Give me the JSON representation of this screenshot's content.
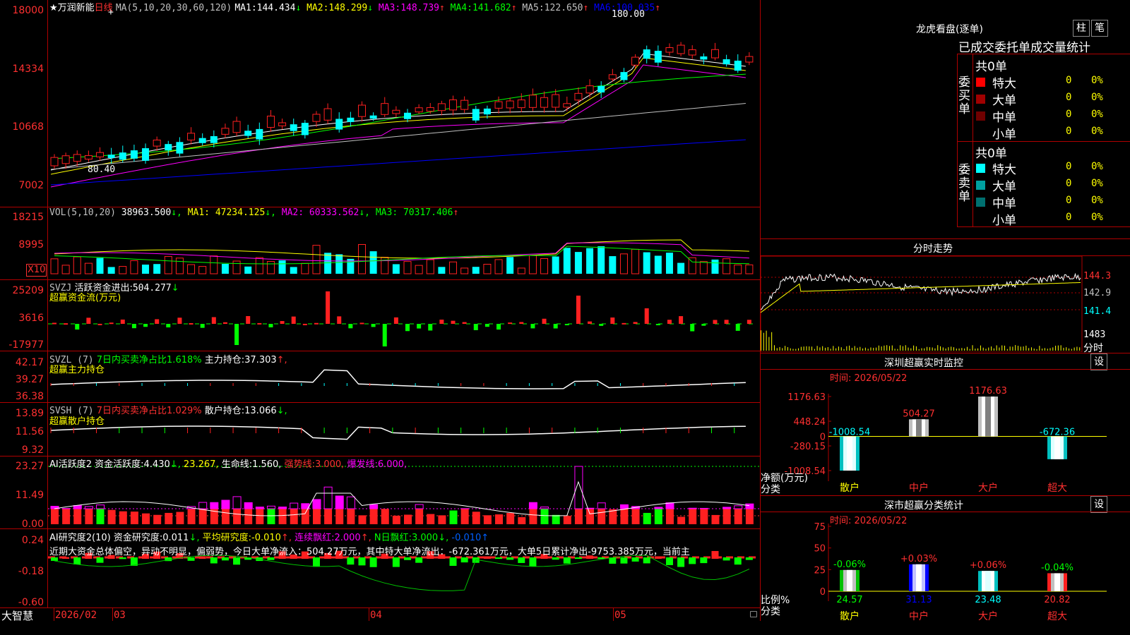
{
  "stock": {
    "star": "★",
    "name": "万润新能",
    "period": "日线",
    "cross": "+"
  },
  "colors": {
    "up": "#ff2020",
    "down": "#00ffff",
    "ma1": "#ffffff",
    "ma2": "#ffff00",
    "ma3": "#ff00ff",
    "ma4": "#00ff00",
    "ma5": "#c0c0c0",
    "ma6": "#0000ff",
    "grid": "#b00000"
  },
  "main": {
    "ma_header": "MA(5,10,20,30,60,120)",
    "ma": [
      {
        "name": "MA1:",
        "value": "144.434",
        "arrow": "↓",
        "color": "#ffffff"
      },
      {
        "name": "MA2:",
        "value": "148.299",
        "arrow": "↓",
        "color": "#ffff00"
      },
      {
        "name": "MA3:",
        "value": "148.739",
        "arrow": "↑",
        "color": "#ff00ff"
      },
      {
        "name": "MA4:",
        "value": "141.682",
        "arrow": "↑",
        "color": "#00ff00"
      },
      {
        "name": "MA5:",
        "value": "122.650",
        "arrow": "↑",
        "color": "#c0c0c0"
      },
      {
        "name": "MA6:",
        "value": "100.035",
        "arrow": "↑",
        "color": "#0000ff"
      }
    ],
    "axis": [
      "18000",
      "14334",
      "10668",
      "7002"
    ],
    "high_label": "180.00",
    "low_label": "80.40"
  },
  "vol": {
    "header": "VOL(5,10,20)",
    "value": "38963.500",
    "value_arrow": "↓",
    "ma": [
      {
        "name": "MA1:",
        "value": "47234.125",
        "arrow": "↓",
        "color": "#ffff00"
      },
      {
        "name": "MA2:",
        "value": "60333.562",
        "arrow": "↓",
        "color": "#ff00ff"
      },
      {
        "name": "MA3:",
        "value": "70317.406",
        "arrow": "↑",
        "color": "#00ff00"
      }
    ],
    "axis": [
      "18215",
      "8995"
    ],
    "unit": "X10"
  },
  "svzj": {
    "header": "SVZJ",
    "label": "活跃资金进出:",
    "value": "504.277",
    "arrow": "↓",
    "title2": "超赢资金流(万元)",
    "axis": [
      "25209",
      "3616",
      "-17977"
    ]
  },
  "svzl": {
    "header": "SVZL (7)",
    "ratio_label": "7日内买卖净占比1.618%",
    "hold_label": "主力持仓:",
    "hold_value": "37.303",
    "arrow": "↑,",
    "title2": "超赢主力持仓",
    "axis": [
      "42.17",
      "39.27",
      "36.38"
    ]
  },
  "svsh": {
    "header": "SVSH (7)",
    "ratio_label": "7日内买卖净占比1.029%",
    "hold_label": "散户持仓:",
    "hold_value": "13.066",
    "arrow": "↓,",
    "title2": "超赢散户持仓",
    "axis": [
      "13.89",
      "11.56",
      "9.32"
    ]
  },
  "ai_active": {
    "header": "AI活跃度2",
    "label": "资金活跃度:",
    "value": "4.430",
    "arrow": "↓,",
    "v2": "23.267,",
    "life_label": "生命线:",
    "life_value": "1.560,",
    "strong_label": "强势线:",
    "strong_value": "3.000,",
    "burst_label": "爆发线:",
    "burst_value": "6.000,",
    "axis": [
      "23.27",
      "11.49",
      "0.00"
    ]
  },
  "ai_research": {
    "header": "AI研究度2(10)",
    "label": "资金研究度:",
    "value": "0.011",
    "arrow": "↓,",
    "avg_label": "平均研究度:",
    "avg_value": "-0.010",
    "avg_arrow": "↑,",
    "cont_label": "连续飘红:",
    "cont_value": "2.000",
    "cont_arrow": "↑,",
    "n_label": "N日飘红:",
    "n_value": "3.000",
    "n_arrow": "↓,",
    "tail": "-0.010↑",
    "comment": "近期大资金总体偏空，异动不明显，偏弱势，今日大单净流入：504.27万元，其中特大单净流出：-672.361万元，大单5日累计净出-9753.385万元，当前主",
    "axis": [
      "0.24",
      "-0.18",
      "-0.60"
    ]
  },
  "bottom": {
    "brand": "大智慧",
    "dates": [
      "2026/02",
      "03",
      "04",
      "05"
    ]
  },
  "dragon": {
    "title": "龙虎看盘(逐单)",
    "btn1": "柱",
    "btn2": "笔",
    "subtitle": "已成交委托单成交量统计",
    "buy": {
      "side": "委买单",
      "total": "共0单",
      "rows": [
        {
          "label": "特大",
          "count": "0",
          "pct": "0%",
          "color": "#ff0000"
        },
        {
          "label": "大单",
          "count": "0",
          "pct": "0%",
          "color": "#a00000"
        },
        {
          "label": "中单",
          "count": "0",
          "pct": "0%",
          "color": "#700000"
        },
        {
          "label": "小单",
          "count": "0",
          "pct": "0%",
          "color": "#000000"
        }
      ]
    },
    "sell": {
      "side": "委卖单",
      "total": "共0单",
      "rows": [
        {
          "label": "特大",
          "count": "0",
          "pct": "0%",
          "color": "#00ffff"
        },
        {
          "label": "大单",
          "count": "0",
          "pct": "0%",
          "color": "#00a0a0"
        },
        {
          "label": "中单",
          "count": "0",
          "pct": "0%",
          "color": "#007070"
        },
        {
          "label": "小单",
          "count": "0",
          "pct": "0%",
          "color": "#000000"
        }
      ]
    }
  },
  "intraday": {
    "title": "分时走势",
    "axis": [
      "144.3",
      "142.9",
      "141.4",
      "1483"
    ],
    "tag": "分时"
  },
  "monitor": {
    "title": "深圳超赢实时监控",
    "btn": "设",
    "time": "时间: 2026/05/22",
    "axis": [
      "1176.63",
      "448.24",
      "0",
      "-280.15",
      "-1008.54"
    ],
    "ylabel": "净额(万元)",
    "xlabel": "分类",
    "chart_data": {
      "type": "bar",
      "categories": [
        "散户",
        "中户",
        "大户",
        "超大"
      ],
      "values": [
        -1008.54,
        504.27,
        1176.63,
        -672.36
      ],
      "ylabel": "净额(万元)",
      "xlabel": "分类",
      "ylim": [
        -1008.54,
        1176.63
      ]
    },
    "bar_labels": [
      "-1008.54",
      "504.27",
      "1176.63",
      "-672.36"
    ]
  },
  "classify": {
    "title": "深市超赢分类统计",
    "btn": "设",
    "time": "时间: 2026/05/22",
    "axis": [
      "75",
      "50",
      "25",
      "0"
    ],
    "ylabel": "比例%",
    "xlabel": "分类",
    "chart_data": {
      "type": "bar",
      "categories": [
        "散户",
        "中户",
        "大户",
        "超大"
      ],
      "values": [
        24.57,
        31.13,
        23.48,
        20.82
      ],
      "changes": [
        "-0.06%",
        "+0.03%",
        "+0.06%",
        "-0.04%"
      ],
      "ylabel": "比例%",
      "xlabel": "分类",
      "ylim": [
        0,
        75
      ]
    },
    "value_labels": [
      "24.57",
      "31.13",
      "23.48",
      "20.82"
    ]
  }
}
